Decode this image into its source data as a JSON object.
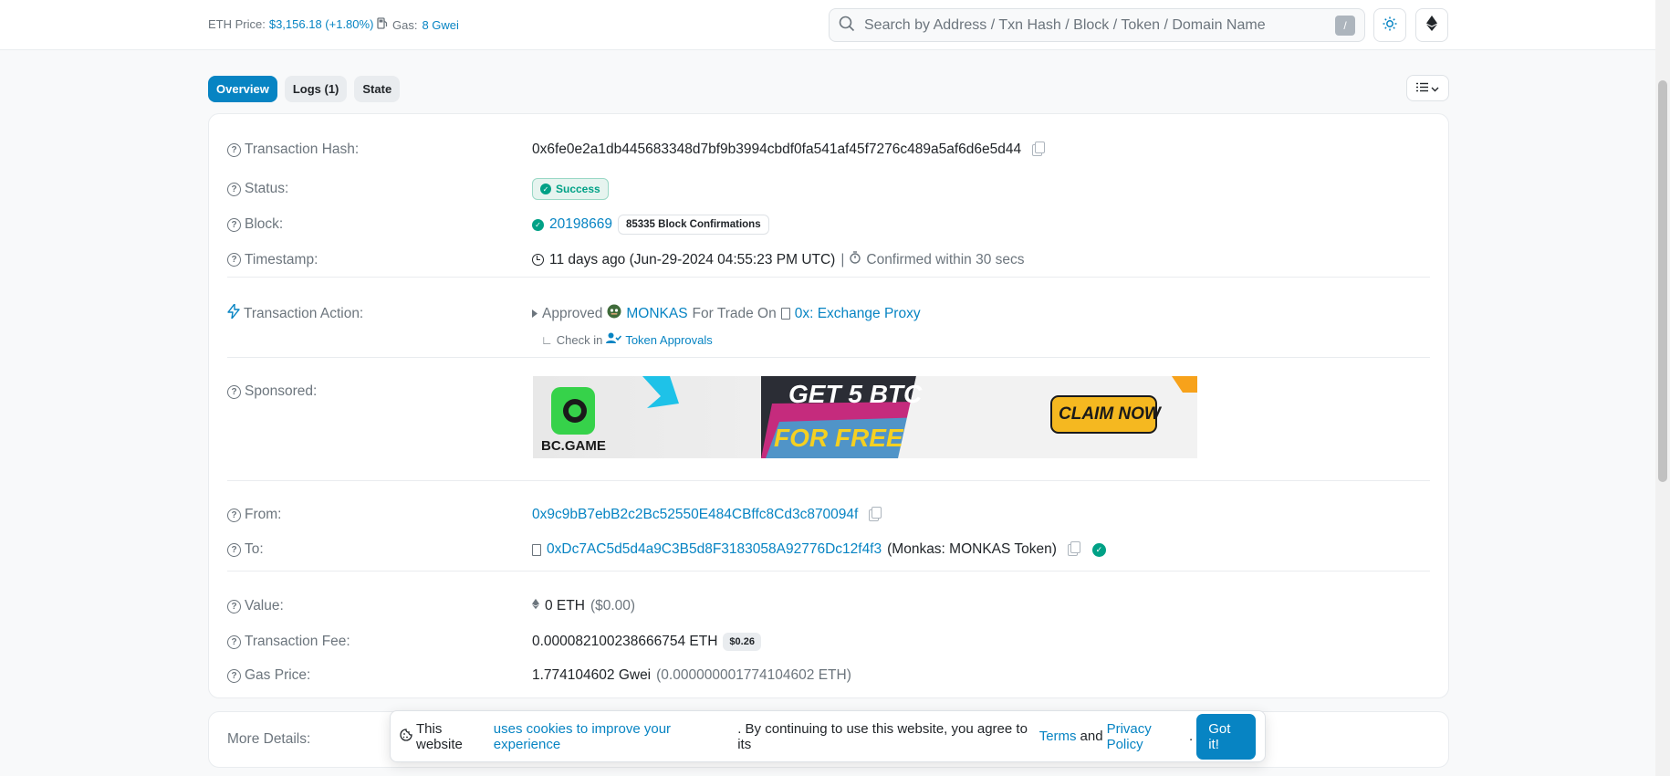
{
  "header": {
    "eth_price_label": "ETH Price:",
    "eth_price_value": "$3,156.18 (+1.80%)",
    "gas_label": "Gas:",
    "gas_value": "8 Gwei",
    "search_placeholder": "Search by Address / Txn Hash / Block / Token / Domain Name",
    "search_shortcut": "/"
  },
  "tabs": [
    {
      "label": "Overview",
      "active": true
    },
    {
      "label": "Logs (1)",
      "active": false
    },
    {
      "label": "State",
      "active": false
    }
  ],
  "tx": {
    "hash_label": "Transaction Hash:",
    "hash": "0x6fe0e2a1db445683348d7bf9b3994cbdf0fa541af45f7276c489a5af6d6e5d44",
    "status_label": "Status:",
    "status": "Success",
    "block_label": "Block:",
    "block": "20198669",
    "confirmations": "85335 Block Confirmations",
    "timestamp_label": "Timestamp:",
    "timestamp": "11 days ago (Jun-29-2024 04:55:23 PM UTC)",
    "timestamp_sep": "|",
    "confirmed": "Confirmed within 30 secs",
    "action_label": "Transaction Action:",
    "action_approved": "Approved",
    "action_token": "MONKAS",
    "action_for_trade": "For Trade On",
    "action_exchange": "0x: Exchange Proxy",
    "action_check": "Check in",
    "action_token_approvals": "Token Approvals",
    "sponsored_label": "Sponsored:",
    "from_label": "From:",
    "from": "0x9c9bB7ebB2c2Bc52550E484CBffc8Cd3c870094f",
    "to_label": "To:",
    "to": "0xDc7AC5d5d4a9C3B5d8F3183058A92776Dc12f4f3",
    "to_name": "(Monkas: MONKAS Token)",
    "value_label": "Value:",
    "value": "0 ETH",
    "value_usd": "($0.00)",
    "fee_label": "Transaction Fee:",
    "fee": "0.000082100238666754 ETH",
    "fee_usd": "$0.26",
    "gas_price_label": "Gas Price:",
    "gas_price": "1.774104602 Gwei",
    "gas_price_eth": "(0.000000001774104602 ETH)"
  },
  "banner": {
    "brand": "BC.GAME",
    "headline_1": "GET 5 BTC",
    "headline_2": "FOR FREE",
    "cta": "CLAIM NOW"
  },
  "more": {
    "label": "More Details:"
  },
  "cookie": {
    "text_1": "This website",
    "link_1": "uses cookies to improve your experience",
    "text_2": ". By continuing to use this website, you agree to its",
    "link_terms": "Terms",
    "text_and": "and",
    "link_privacy": "Privacy Policy",
    "text_end": ".",
    "button": "Got it!"
  },
  "colors": {
    "accent": "#0784c3",
    "success": "#00a186",
    "muted": "#6c757d"
  }
}
